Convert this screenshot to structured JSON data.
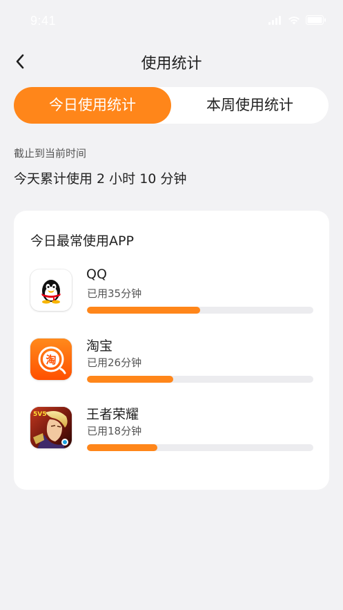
{
  "status_bar": {
    "time": "9:41"
  },
  "nav": {
    "title": "使用统计",
    "back_icon": "chevron-left-icon"
  },
  "tabs": [
    {
      "label": "今日使用统计",
      "active": true
    },
    {
      "label": "本周使用统计",
      "active": false
    }
  ],
  "summary": {
    "caption": "截止到当前时间",
    "total_text": "今天累计使用 2 小时 10 分钟"
  },
  "card": {
    "title": "今日最常使用APP",
    "apps": [
      {
        "name": "QQ",
        "usage_text": "已用35分钟",
        "progress": 0.5,
        "icon": "qq-penguin-icon"
      },
      {
        "name": "淘宝",
        "usage_text": "已用26分钟",
        "progress": 0.38,
        "icon": "taobao-icon"
      },
      {
        "name": "王者荣耀",
        "usage_text": "已用18分钟",
        "progress": 0.31,
        "icon": "honor-of-kings-icon"
      }
    ]
  },
  "colors": {
    "accent": "#ff861a",
    "background": "#f2f2f4",
    "card": "#ffffff",
    "track": "#ececef"
  }
}
